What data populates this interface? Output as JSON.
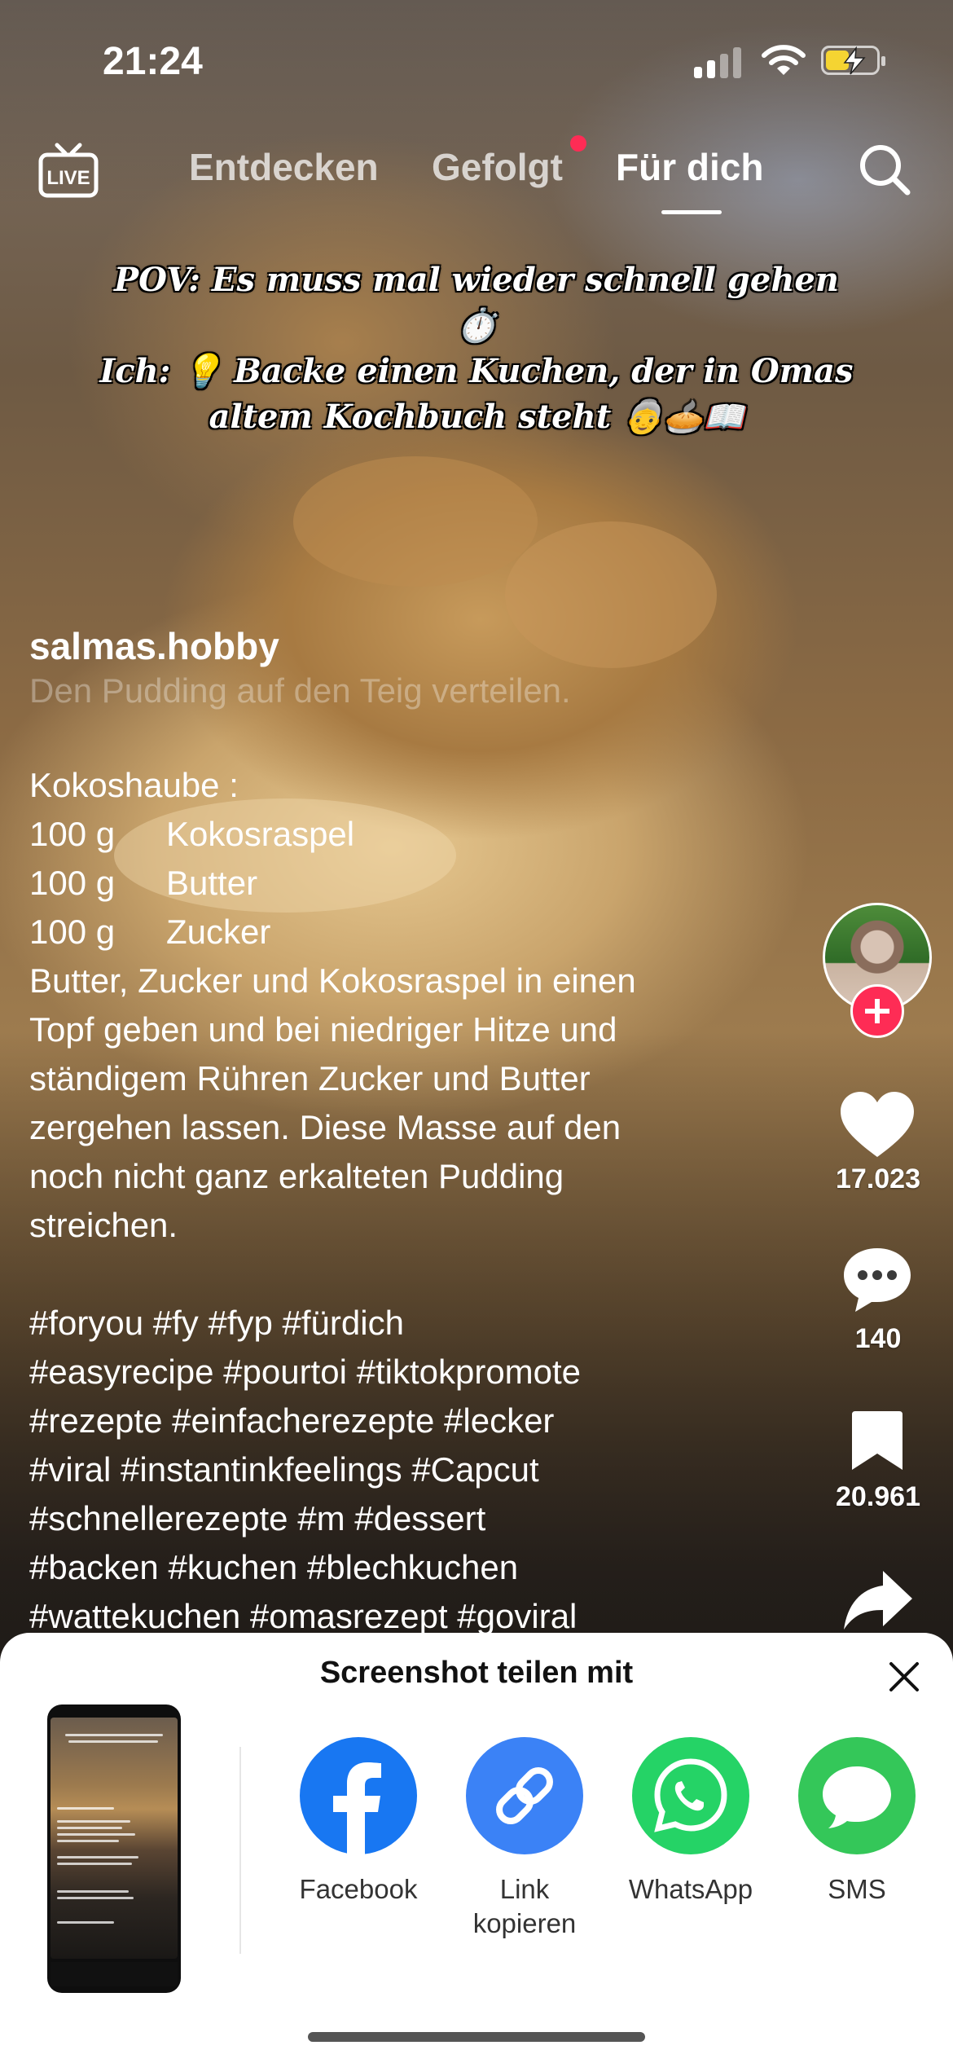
{
  "status_bar": {
    "time": "21:24"
  },
  "nav": {
    "tabs": [
      {
        "label": "Entdecken"
      },
      {
        "label": "Gefolgt"
      },
      {
        "label": "Für dich"
      }
    ],
    "active_tab": "Für dich",
    "live_label": "LIVE"
  },
  "video": {
    "caption_lines": [
      "POV: Es muss mal wieder schnell gehen ⏱️",
      "Ich: 💡 Backe einen Kuchen, der in Omas",
      "altem Kochbuch steht 👵🥧📖"
    ]
  },
  "post": {
    "username": "salmas.hobby",
    "faded_line": "Den Pudding auf den Teig verteilen.",
    "section_title": "Kokoshaube :",
    "ingredients": [
      {
        "qty": "100 g",
        "name": "Kokosraspel"
      },
      {
        "qty": "100 g",
        "name": "Butter"
      },
      {
        "qty": "100 g",
        "name": "Zucker"
      }
    ],
    "instructions": [
      "Butter, Zucker und Kokosraspel in einen",
      "Topf geben und bei niedriger Hitze und",
      "ständigem Rühren Zucker und Butter",
      "zergehen lassen. Diese Masse auf den",
      "noch nicht ganz erkalteten Pudding",
      "streichen."
    ],
    "hashtag_lines": [
      "#foryou #fy #fyp  #fürdich",
      "#easyrecipe #pourtoi #tiktokpromote",
      "#rezepte #einfacherezepte #lecker",
      "#viral #instantinkfeelings #Capcut",
      "#schnellerezepte  #m #dessert",
      "#backen #kuchen #blechkuchen",
      "#wattekuchen #omasrezept #goviral"
    ]
  },
  "actions": {
    "likes": "17.023",
    "comments": "140",
    "saves": "20.961"
  },
  "share_sheet": {
    "title": "Screenshot teilen mit",
    "targets": [
      {
        "label": "Facebook",
        "color": "#1877f2",
        "icon": "facebook-icon"
      },
      {
        "label": "Link kopieren",
        "color": "#3b82f6",
        "icon": "link-icon"
      },
      {
        "label": "WhatsApp",
        "color": "#25d366",
        "icon": "whatsapp-icon"
      },
      {
        "label": "SMS",
        "color": "#34c759",
        "icon": "message-icon"
      }
    ]
  },
  "colors": {
    "accent": "#fe2c55",
    "battery": "#f5d432"
  }
}
